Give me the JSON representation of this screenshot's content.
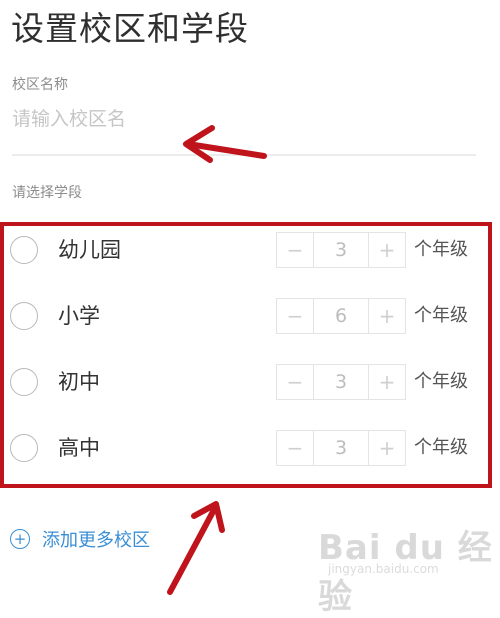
{
  "page": {
    "title": "设置校区和学段"
  },
  "campus": {
    "label": "校区名称",
    "placeholder": "请输入校区名",
    "value": ""
  },
  "stages": {
    "label": "请选择学段",
    "grade_unit": "个年级",
    "minus": "−",
    "plus": "+",
    "items": [
      {
        "name": "幼儿园",
        "count": "3",
        "selected": false
      },
      {
        "name": "小学",
        "count": "6",
        "selected": false
      },
      {
        "name": "初中",
        "count": "3",
        "selected": false
      },
      {
        "name": "高中",
        "count": "3",
        "selected": false
      }
    ]
  },
  "add_more": {
    "icon": "plus-circle-icon",
    "label": "添加更多校区"
  },
  "watermark": {
    "logo": "Bai du 经验",
    "url": "jingyan.baidu.com"
  },
  "colors": {
    "annotation_red": "#c0141c",
    "link_blue": "#3a8fd6"
  }
}
